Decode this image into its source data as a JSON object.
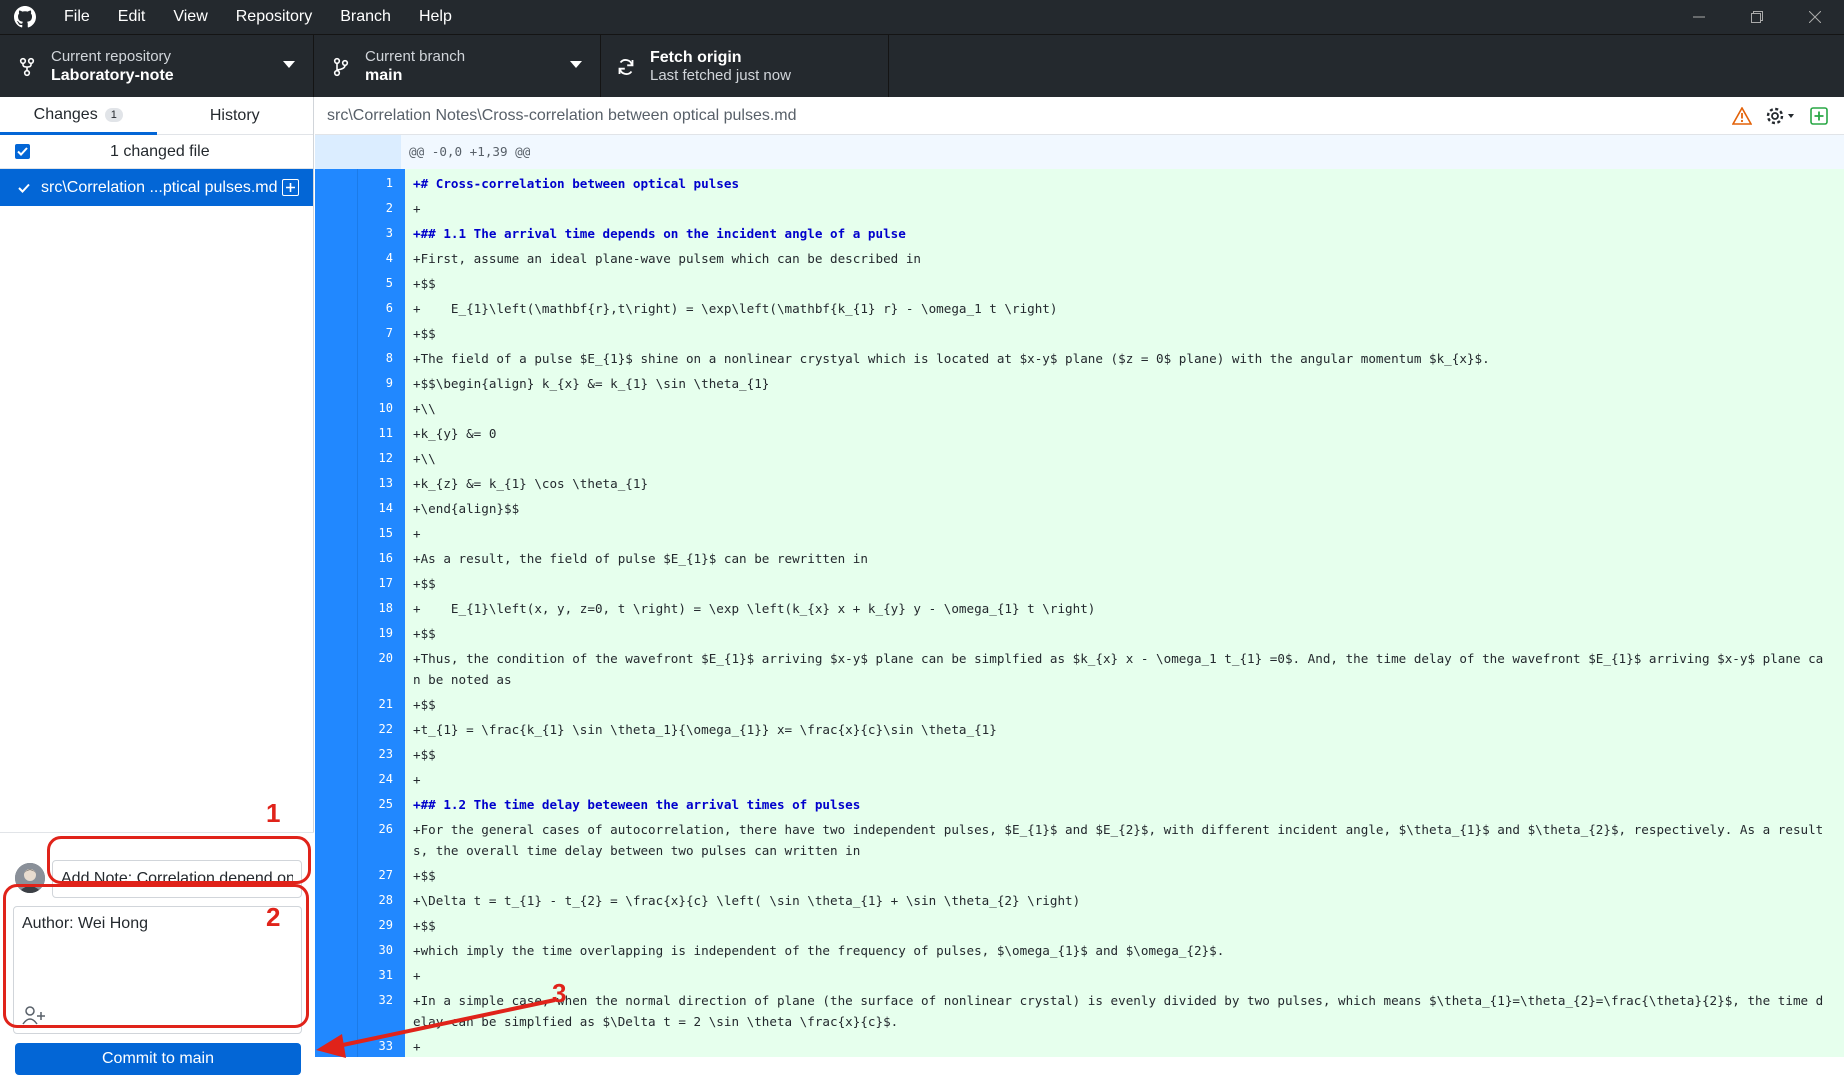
{
  "menu": [
    "File",
    "Edit",
    "View",
    "Repository",
    "Branch",
    "Help"
  ],
  "toolbar": {
    "repo_label": "Current repository",
    "repo_value": "Laboratory-note",
    "branch_label": "Current branch",
    "branch_value": "main",
    "fetch_label": "Fetch origin",
    "fetch_value": "Last fetched just now"
  },
  "sidebar": {
    "tab_changes": "Changes",
    "tab_changes_count": "1",
    "tab_history": "History",
    "changed_header": "1 changed file",
    "file_name": "src\\Correlation ...ptical pulses.md"
  },
  "commit": {
    "summary_value": "Add Note: Correlation depend on",
    "description": "Author: Wei Hong",
    "button_label": "Commit to main"
  },
  "annotations": {
    "label1": "1",
    "label2": "2",
    "label3": "3"
  },
  "diff": {
    "path": "src\\Correlation Notes\\Cross-correlation between optical pulses.md",
    "hunk": "@@ -0,0 +1,39 @@",
    "lines": [
      {
        "n": "1",
        "t": "+# Cross-correlation between optical pulses",
        "h": true
      },
      {
        "n": "2",
        "t": "+"
      },
      {
        "n": "3",
        "t": "+## 1.1 The arrival time depends on the incident angle of a pulse",
        "h": true
      },
      {
        "n": "4",
        "t": "+First, assume an ideal plane-wave pulsem which can be described in"
      },
      {
        "n": "5",
        "t": "+$$"
      },
      {
        "n": "6",
        "t": "+    E_{1}\\left(\\mathbf{r},t\\right) = \\exp\\left(\\mathbf{k_{1} r} - \\omega_1 t \\right)"
      },
      {
        "n": "7",
        "t": "+$$"
      },
      {
        "n": "8",
        "t": "+The field of a pulse $E_{1}$ shine on a nonlinear crystyal which is located at $x-y$ plane ($z = 0$ plane) with the angular momentum $k_{x}$."
      },
      {
        "n": "9",
        "t": "+$$\\begin{align} k_{x} &= k_{1} \\sin \\theta_{1}"
      },
      {
        "n": "10",
        "t": "+\\\\"
      },
      {
        "n": "11",
        "t": "+k_{y} &= 0"
      },
      {
        "n": "12",
        "t": "+\\\\"
      },
      {
        "n": "13",
        "t": "+k_{z} &= k_{1} \\cos \\theta_{1}"
      },
      {
        "n": "14",
        "t": "+\\end{align}$$"
      },
      {
        "n": "15",
        "t": "+"
      },
      {
        "n": "16",
        "t": "+As a result, the field of pulse $E_{1}$ can be rewritten in"
      },
      {
        "n": "17",
        "t": "+$$"
      },
      {
        "n": "18",
        "t": "+    E_{1}\\left(x, y, z=0, t \\right) = \\exp \\left(k_{x} x + k_{y} y - \\omega_{1} t \\right)"
      },
      {
        "n": "19",
        "t": "+$$"
      },
      {
        "n": "20",
        "t": "+Thus, the condition of the wavefront $E_{1}$ arriving $x-y$ plane can be simplfied as $k_{x} x - \\omega_1 t_{1} =0$. And, the time delay of the wavefront $E_{1}$ arriving $x-y$ plane can be noted as"
      },
      {
        "n": "21",
        "t": "+$$"
      },
      {
        "n": "22",
        "t": "+t_{1} = \\frac{k_{1} \\sin \\theta_1}{\\omega_{1}} x= \\frac{x}{c}\\sin \\theta_{1}"
      },
      {
        "n": "23",
        "t": "+$$"
      },
      {
        "n": "24",
        "t": "+"
      },
      {
        "n": "25",
        "t": "+## 1.2 The time delay beteween the arrival times of pulses",
        "h": true
      },
      {
        "n": "26",
        "t": "+For the general cases of autocorrelation, there have two independent pulses, $E_{1}$ and $E_{2}$, with different incident angle, $\\theta_{1}$ and $\\theta_{2}$, respectively. As a results, the overall time delay between two pulses can written in"
      },
      {
        "n": "27",
        "t": "+$$"
      },
      {
        "n": "28",
        "t": "+\\Delta t = t_{1} - t_{2} = \\frac{x}{c} \\left( \\sin \\theta_{1} + \\sin \\theta_{2} \\right)"
      },
      {
        "n": "29",
        "t": "+$$"
      },
      {
        "n": "30",
        "t": "+which imply the time overlapping is independent of the frequency of pulses, $\\omega_{1}$ and $\\omega_{2}$."
      },
      {
        "n": "31",
        "t": "+"
      },
      {
        "n": "32",
        "t": "+In a simple case, when the normal direction of plane (the surface of nonlinear crystal) is evenly divided by two pulses, which means $\\theta_{1}=\\theta_{2}=\\frac{\\theta}{2}$, the time delay can be simplfied as $\\Delta t = 2 \\sin \\theta \\frac{x}{c}$."
      },
      {
        "n": "33",
        "t": "+"
      }
    ]
  }
}
